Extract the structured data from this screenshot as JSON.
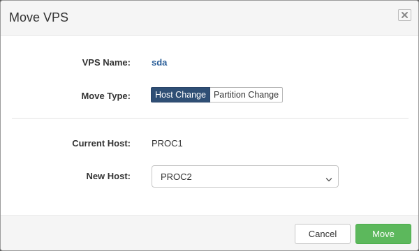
{
  "dialog": {
    "title": "Move VPS"
  },
  "icons": {
    "close": "close-icon",
    "select_chevron": "chevron-down-icon"
  },
  "fields": {
    "vps_name_label": "VPS Name:",
    "vps_name_value": "sda",
    "move_type_label": "Move Type:",
    "move_type_options": [
      "Host Change",
      "Partition Change"
    ],
    "move_type_selected": "Host Change",
    "current_host_label": "Current Host:",
    "current_host_value": "PROC1",
    "new_host_label": "New Host:",
    "new_host_value": "PROC2"
  },
  "footer": {
    "cancel_label": "Cancel",
    "move_label": "Move"
  },
  "colors": {
    "active_segment": "#2f4f75",
    "link": "#2b5f99",
    "primary_button": "#5cb85c"
  }
}
